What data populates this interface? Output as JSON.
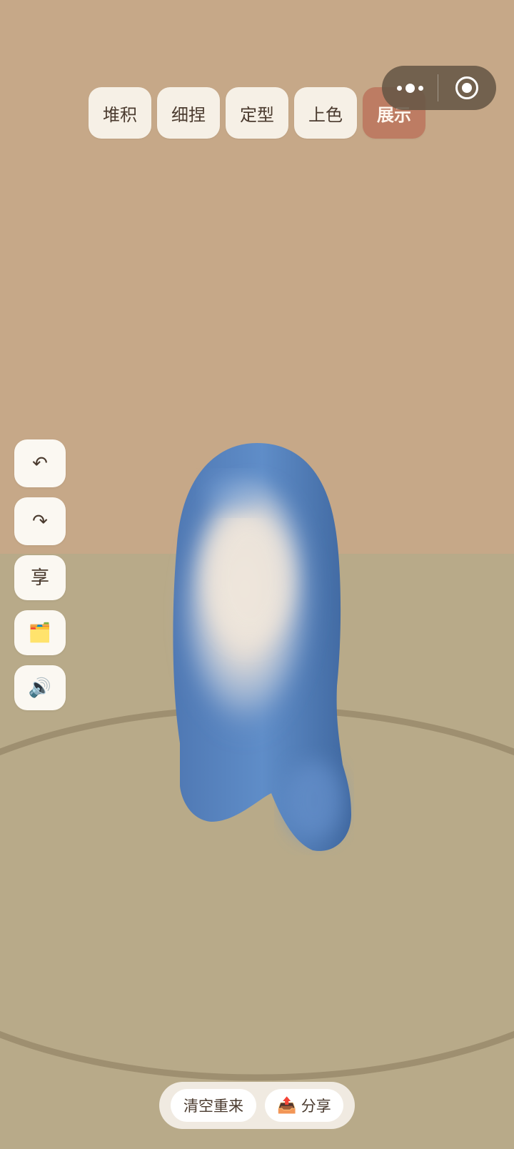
{
  "modes": {
    "tabs": [
      {
        "label": "堆积"
      },
      {
        "label": "细捏"
      },
      {
        "label": "定型"
      },
      {
        "label": "上色"
      },
      {
        "label": "展示",
        "active": true
      }
    ]
  },
  "capsule": {
    "more_icon": "more-dots-icon",
    "close_icon": "target-circle-icon"
  },
  "side_tools": {
    "undo": {
      "glyph": "↶",
      "icon": "undo-icon"
    },
    "redo": {
      "glyph": "↷",
      "icon": "redo-icon"
    },
    "share_char": {
      "glyph": "享",
      "icon": "share-character-icon"
    },
    "gallery": {
      "glyph": "🗂️",
      "icon": "card-index-dividers-icon"
    },
    "sound": {
      "glyph": "🔊",
      "icon": "speaker-icon"
    }
  },
  "actions": {
    "reset_label": "清空重来",
    "share_label": "分享",
    "share_glyph": "📤"
  },
  "colors": {
    "wall": "#c6a888",
    "floor": "#b8aa89",
    "active_tab": "#bd7c63",
    "clay_blue": "#4f7fbf",
    "clay_cream": "#ece4da"
  }
}
